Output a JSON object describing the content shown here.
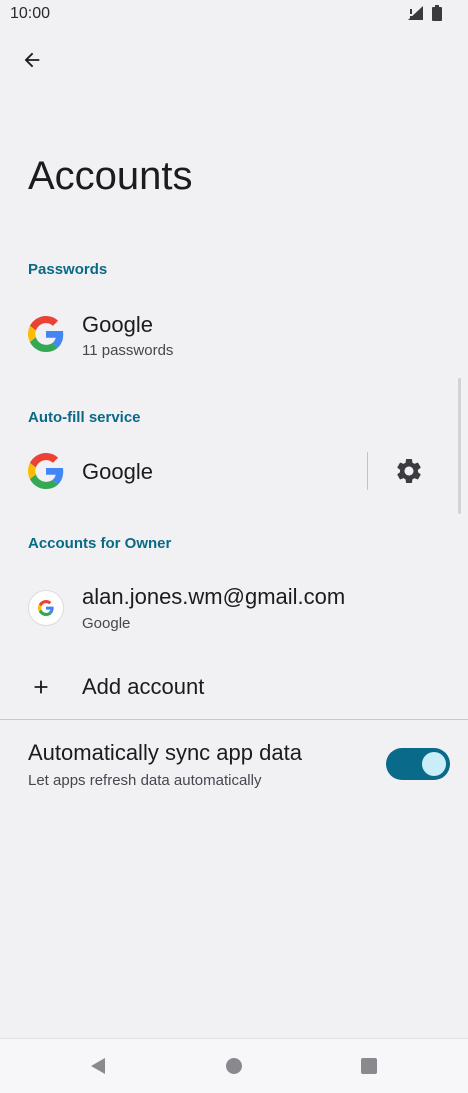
{
  "status": {
    "time": "10:00"
  },
  "page": {
    "title": "Accounts"
  },
  "passwords": {
    "header": "Passwords",
    "item": {
      "title": "Google",
      "subtitle": "11 passwords"
    }
  },
  "autofill": {
    "header": "Auto-fill service",
    "item": {
      "title": "Google"
    }
  },
  "accounts": {
    "header": "Accounts for Owner",
    "item": {
      "title": "alan.jones.wm@gmail.com",
      "subtitle": "Google"
    },
    "add_label": "Add account"
  },
  "sync": {
    "title": "Automatically sync app data",
    "subtitle": "Let apps refresh data automatically",
    "enabled": true
  },
  "colors": {
    "accent": "#0a6a86",
    "toggle": "#0a6a8a",
    "background": "#f1f1f4"
  }
}
